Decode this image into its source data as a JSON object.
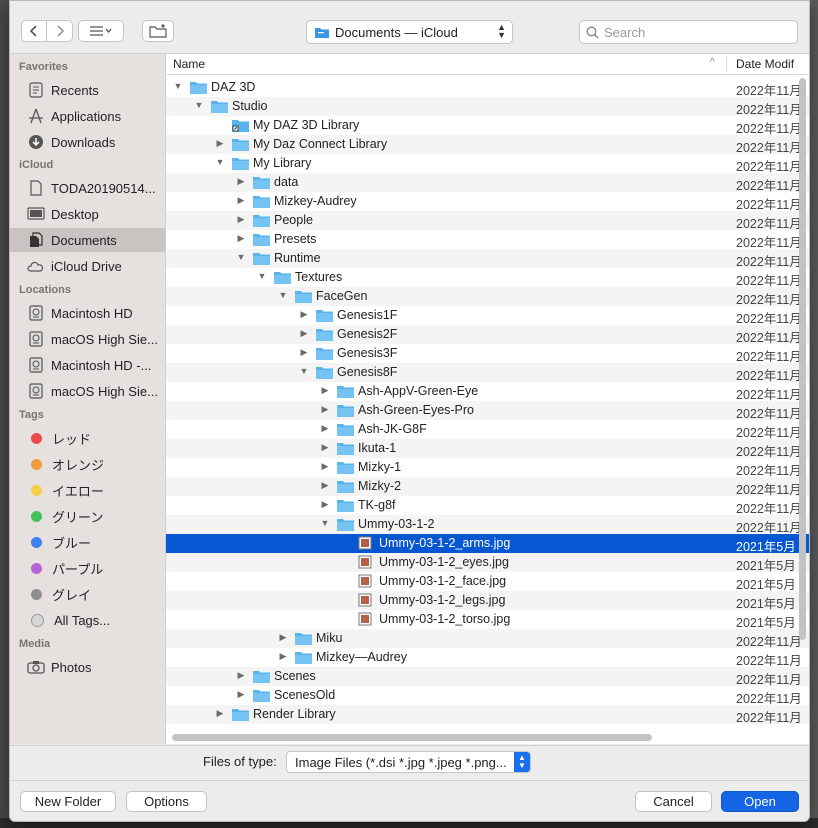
{
  "toolbar": {
    "location": "Documents — iCloud",
    "search_placeholder": "Search"
  },
  "sidebar": {
    "favorites_header": "Favorites",
    "favorites": [
      {
        "label": "Recents",
        "icon": "recents-icon"
      },
      {
        "label": "Applications",
        "icon": "applications-icon"
      },
      {
        "label": "Downloads",
        "icon": "downloads-icon"
      }
    ],
    "icloud_header": "iCloud",
    "icloud": [
      {
        "label": "TODA20190514...",
        "icon": "document-icon"
      },
      {
        "label": "Desktop",
        "icon": "desktop-icon"
      },
      {
        "label": "Documents",
        "icon": "documents-icon"
      },
      {
        "label": "iCloud Drive",
        "icon": "cloud-icon"
      }
    ],
    "locations_header": "Locations",
    "locations": [
      {
        "label": "Macintosh HD",
        "icon": "disk-icon"
      },
      {
        "label": "macOS High Sie...",
        "icon": "disk-icon"
      },
      {
        "label": "Macintosh HD -...",
        "icon": "disk-icon"
      },
      {
        "label": "macOS High Sie...",
        "icon": "disk-icon"
      }
    ],
    "tags_header": "Tags",
    "tags": [
      {
        "label": "レッド",
        "color": "#ec4b4b"
      },
      {
        "label": "オレンジ",
        "color": "#f29b3c"
      },
      {
        "label": "イエロー",
        "color": "#f5cf4a"
      },
      {
        "label": "グリーン",
        "color": "#43c25a"
      },
      {
        "label": "ブルー",
        "color": "#3d82f0"
      },
      {
        "label": "パープル",
        "color": "#b564d6"
      },
      {
        "label": "グレイ",
        "color": "#8f8f8f"
      },
      {
        "label": "All Tags...",
        "color": "#d6d6d6"
      }
    ],
    "media_header": "Media",
    "media": [
      {
        "label": "Photos",
        "icon": "camera-icon"
      }
    ]
  },
  "list": {
    "col_name": "Name",
    "col_date": "Date Modif",
    "rows": [
      {
        "name": "DAZ 3D",
        "level": 0,
        "disc": "open",
        "kind": "folder",
        "date": "2022年11月"
      },
      {
        "name": "Studio",
        "level": 1,
        "disc": "open",
        "kind": "folder",
        "date": "2022年11月"
      },
      {
        "name": "My DAZ 3D Library",
        "level": 2,
        "disc": "none",
        "kind": "alias",
        "date": "2022年11月"
      },
      {
        "name": "My Daz Connect Library",
        "level": 2,
        "disc": "closed",
        "kind": "folder",
        "date": "2022年11月"
      },
      {
        "name": "My Library",
        "level": 2,
        "disc": "open",
        "kind": "folder",
        "date": "2022年11月"
      },
      {
        "name": "data",
        "level": 3,
        "disc": "closed",
        "kind": "folder",
        "date": "2022年11月"
      },
      {
        "name": "Mizkey-Audrey",
        "level": 3,
        "disc": "closed",
        "kind": "folder",
        "date": "2022年11月"
      },
      {
        "name": "People",
        "level": 3,
        "disc": "closed",
        "kind": "folder",
        "date": "2022年11月"
      },
      {
        "name": "Presets",
        "level": 3,
        "disc": "closed",
        "kind": "folder",
        "date": "2022年11月"
      },
      {
        "name": "Runtime",
        "level": 3,
        "disc": "open",
        "kind": "folder",
        "date": "2022年11月"
      },
      {
        "name": "Textures",
        "level": 4,
        "disc": "open",
        "kind": "folder",
        "date": "2022年11月"
      },
      {
        "name": "FaceGen",
        "level": 5,
        "disc": "open",
        "kind": "folder",
        "date": "2022年11月"
      },
      {
        "name": "Genesis1F",
        "level": 6,
        "disc": "closed",
        "kind": "folder",
        "date": "2022年11月"
      },
      {
        "name": "Genesis2F",
        "level": 6,
        "disc": "closed",
        "kind": "folder",
        "date": "2022年11月"
      },
      {
        "name": "Genesis3F",
        "level": 6,
        "disc": "closed",
        "kind": "folder",
        "date": "2022年11月"
      },
      {
        "name": "Genesis8F",
        "level": 6,
        "disc": "open",
        "kind": "folder",
        "date": "2022年11月"
      },
      {
        "name": "Ash-AppV-Green-Eye",
        "level": 7,
        "disc": "closed",
        "kind": "folder",
        "date": "2022年11月"
      },
      {
        "name": "Ash-Green-Eyes-Pro",
        "level": 7,
        "disc": "closed",
        "kind": "folder",
        "date": "2022年11月"
      },
      {
        "name": "Ash-JK-G8F",
        "level": 7,
        "disc": "closed",
        "kind": "folder",
        "date": "2022年11月"
      },
      {
        "name": "Ikuta-1",
        "level": 7,
        "disc": "closed",
        "kind": "folder",
        "date": "2022年11月"
      },
      {
        "name": "Mizky-1",
        "level": 7,
        "disc": "closed",
        "kind": "folder",
        "date": "2022年11月"
      },
      {
        "name": "Mizky-2",
        "level": 7,
        "disc": "closed",
        "kind": "folder",
        "date": "2022年11月"
      },
      {
        "name": "TK-g8f",
        "level": 7,
        "disc": "closed",
        "kind": "folder",
        "date": "2022年11月"
      },
      {
        "name": "Ummy-03-1-2",
        "level": 7,
        "disc": "open",
        "kind": "folder",
        "date": "2022年11月"
      },
      {
        "name": "Ummy-03-1-2_arms.jpg",
        "level": 8,
        "disc": "none",
        "kind": "image",
        "date": "2021年5月",
        "selected": true
      },
      {
        "name": "Ummy-03-1-2_eyes.jpg",
        "level": 8,
        "disc": "none",
        "kind": "image",
        "date": "2021年5月"
      },
      {
        "name": "Ummy-03-1-2_face.jpg",
        "level": 8,
        "disc": "none",
        "kind": "image",
        "date": "2021年5月"
      },
      {
        "name": "Ummy-03-1-2_legs.jpg",
        "level": 8,
        "disc": "none",
        "kind": "image",
        "date": "2021年5月"
      },
      {
        "name": "Ummy-03-1-2_torso.jpg",
        "level": 8,
        "disc": "none",
        "kind": "image",
        "date": "2021年5月"
      },
      {
        "name": "Miku",
        "level": 5,
        "disc": "closed",
        "kind": "folder",
        "date": "2022年11月"
      },
      {
        "name": "Mizkey—Audrey",
        "level": 5,
        "disc": "closed",
        "kind": "folder",
        "date": "2022年11月"
      },
      {
        "name": "Scenes",
        "level": 3,
        "disc": "closed",
        "kind": "folder",
        "date": "2022年11月"
      },
      {
        "name": "ScenesOld",
        "level": 3,
        "disc": "closed",
        "kind": "folder",
        "date": "2022年11月"
      },
      {
        "name": "Render Library",
        "level": 2,
        "disc": "closed",
        "kind": "folder",
        "date": "2022年11月"
      }
    ]
  },
  "filetypes": {
    "label": "Files of type:",
    "value": "Image Files (*.dsi *.jpg *.jpeg *.png..."
  },
  "actions": {
    "new_folder": "New Folder",
    "options": "Options",
    "cancel": "Cancel",
    "open": "Open"
  },
  "colors": {
    "accent": "#0757d3",
    "folder": "#5ab4ec"
  }
}
